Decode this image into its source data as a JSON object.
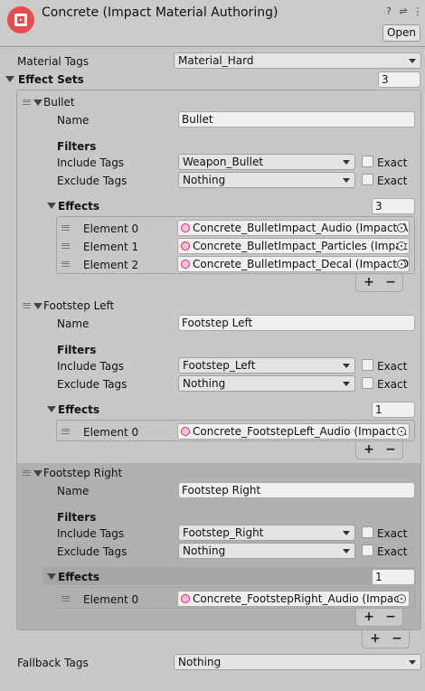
{
  "header": {
    "title": "Concrete (Impact Material Authoring)",
    "open_button": "Open"
  },
  "material_tags": {
    "label": "Material Tags",
    "value": "Material_Hard"
  },
  "effect_sets": {
    "label": "Effect Sets",
    "count": "3",
    "sets": [
      {
        "name_header": "Bullet",
        "name_label": "Name",
        "name_value": "Bullet",
        "filters_label": "Filters",
        "include_label": "Include Tags",
        "include_value": "Weapon_Bullet",
        "exclude_label": "Exclude Tags",
        "exclude_value": "Nothing",
        "exact_label": "Exact",
        "effects_label": "Effects",
        "effects_count": "3",
        "elements": [
          {
            "label": "Element 0",
            "value": "Concrete_BulletImpact_Audio (Impact A",
            "icon": "audio-icon"
          },
          {
            "label": "Element 1",
            "value": "Concrete_BulletImpact_Particles (Impac",
            "icon": "particles-icon"
          },
          {
            "label": "Element 2",
            "value": "Concrete_BulletImpact_Decal (Impact D",
            "icon": "decal-icon"
          }
        ]
      },
      {
        "name_header": "Footstep Left",
        "name_label": "Name",
        "name_value": "Footstep Left",
        "filters_label": "Filters",
        "include_label": "Include Tags",
        "include_value": "Footstep_Left",
        "exclude_label": "Exclude Tags",
        "exclude_value": "Nothing",
        "exact_label": "Exact",
        "effects_label": "Effects",
        "effects_count": "1",
        "elements": [
          {
            "label": "Element 0",
            "value": "Concrete_FootstepLeft_Audio (Impact A",
            "icon": "audio-icon"
          }
        ]
      },
      {
        "name_header": "Footstep Right",
        "name_label": "Name",
        "name_value": "Footstep Right",
        "filters_label": "Filters",
        "include_label": "Include Tags",
        "include_value": "Footstep_Right",
        "exclude_label": "Exclude Tags",
        "exclude_value": "Nothing",
        "exact_label": "Exact",
        "effects_label": "Effects",
        "effects_count": "1",
        "elements": [
          {
            "label": "Element 0",
            "value": "Concrete_FootstepRight_Audio (Impact",
            "icon": "audio-icon"
          }
        ]
      }
    ]
  },
  "fallback_tags": {
    "label": "Fallback Tags",
    "value": "Nothing"
  },
  "list_buttons": {
    "plus": "+",
    "minus": "−"
  }
}
